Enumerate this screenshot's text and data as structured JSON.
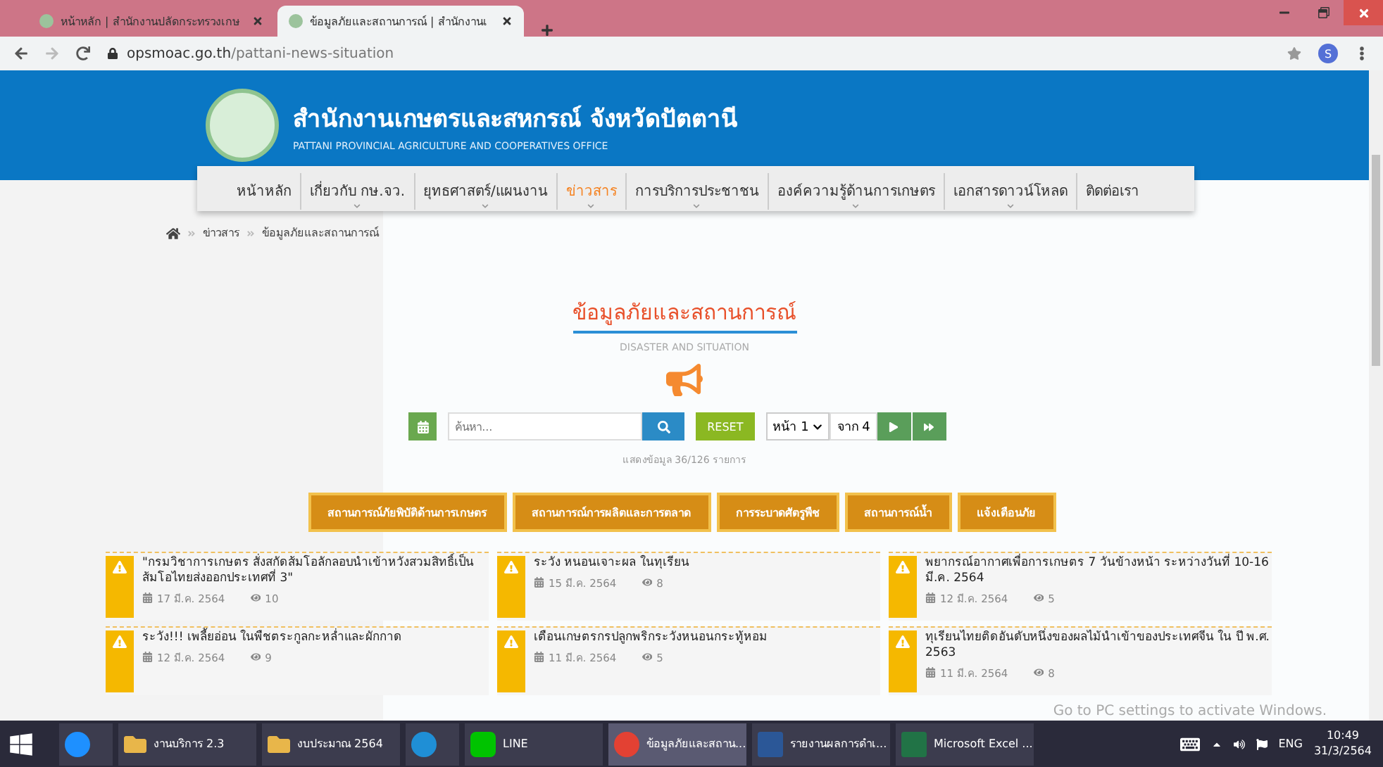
{
  "browser": {
    "tabs": [
      {
        "title": "หน้าหลัก | สำนักงานปลัดกระทรวงเกษ",
        "selected": false
      },
      {
        "title": "ข้อมูลภัยและสถานการณ์ | สำนักงานเ",
        "selected": true
      }
    ],
    "url_host": "opsmoac.go.th",
    "url_path": "/pattani-news-situation",
    "profile_initial": "S"
  },
  "site": {
    "title": "สำนักงานเกษตรและสหกรณ์ จังหวัดปัตตานี",
    "subtitle": "PATTANI PROVINCIAL AGRICULTURE AND COOPERATIVES OFFICE",
    "nav": [
      {
        "label": "หน้าหลัก",
        "selected": false,
        "dropdown": false
      },
      {
        "label": "เกี่ยวกับ กษ.จว.",
        "selected": false,
        "dropdown": true
      },
      {
        "label": "ยุทธศาสตร์/แผนงาน",
        "selected": false,
        "dropdown": true
      },
      {
        "label": "ข่าวสาร",
        "selected": true,
        "dropdown": true
      },
      {
        "label": "การบริการประชาชน",
        "selected": false,
        "dropdown": true
      },
      {
        "label": "องค์ความรู้ด้านการเกษตร",
        "selected": false,
        "dropdown": true
      },
      {
        "label": "เอกสารดาวน์โหลด",
        "selected": false,
        "dropdown": true
      },
      {
        "label": "ติดต่อเรา",
        "selected": false,
        "dropdown": false
      }
    ],
    "breadcrumb": [
      "ข่าวสาร",
      "ข้อมูลภัยและสถานการณ์"
    ]
  },
  "section": {
    "title": "ข้อมูลภัยและสถานการณ์",
    "subtitle": "DISASTER AND SITUATION",
    "search_placeholder": "ค้นหา...",
    "reset": "RESET",
    "page": "หน้า 1",
    "of_pages": "จาก 4",
    "count": "แสดงข้อมูล 36/126 รายการ",
    "categories": [
      "สถานการณ์ภัยพิบัติด้านการเกษตร",
      "สถานการณ์การผลิตและการตลาด",
      "การระบาดศัตรูพืช",
      "สถานการณ์น้ำ",
      "แจ้งเตือนภัย"
    ],
    "news": [
      {
        "title": "\"กรมวิชาการเกษตร สั่งสกัดส้มโอลักลอบนำเข้าหวังสวมสิทธิ์เป็นส้มโอไทยส่งออกประเทศที่ 3\"",
        "date": "17 มี.ค. 2564",
        "views": "10"
      },
      {
        "title": "ระวัง หนอนเจาะผล ในทุเรียน",
        "date": "15 มี.ค. 2564",
        "views": "8"
      },
      {
        "title": "พยากรณ์อากาศเพื่อการเกษตร 7 วันข้างหน้า ระหว่างวันที่ 10-16 มี.ค. 2564",
        "date": "12 มี.ค. 2564",
        "views": "5"
      },
      {
        "title": "ระวัง!!! เพลี้ยอ่อน ในพืชตระกูลกะหล่ำและผักกาด",
        "date": "12 มี.ค. 2564",
        "views": "9"
      },
      {
        "title": "เตือนเกษตรกรปลูกพริกระวังหนอนกระทู้หอม",
        "date": "11 มี.ค. 2564",
        "views": "5"
      },
      {
        "title": "ทุเรียนไทยติดอันดับหนึ่งของผลไม้นำเข้าของประเทศจีน ใน ปี พ.ศ. 2563",
        "date": "11 มี.ค. 2564",
        "views": "8"
      }
    ]
  },
  "activation_notice": "Go to PC settings to activate Windows.",
  "taskbar": {
    "items": [
      {
        "kind": "browser-e",
        "active": false
      },
      {
        "kind": "folder",
        "label": "งานบริการ 2.3",
        "active": false
      },
      {
        "kind": "folder",
        "label": "งบประมาณ 2564",
        "active": false
      },
      {
        "kind": "edge",
        "active": false
      },
      {
        "kind": "line",
        "label": "LINE",
        "active": false
      },
      {
        "kind": "chrome",
        "label": "ข้อมูลภัยและสถาน...",
        "active": true
      },
      {
        "kind": "word",
        "label": "รายงานผลการดำเ...",
        "active": false
      },
      {
        "kind": "excel",
        "label": "Microsoft Excel ...",
        "active": false
      }
    ],
    "lang": "ENG",
    "time": "10:49",
    "date": "31/3/2564"
  }
}
